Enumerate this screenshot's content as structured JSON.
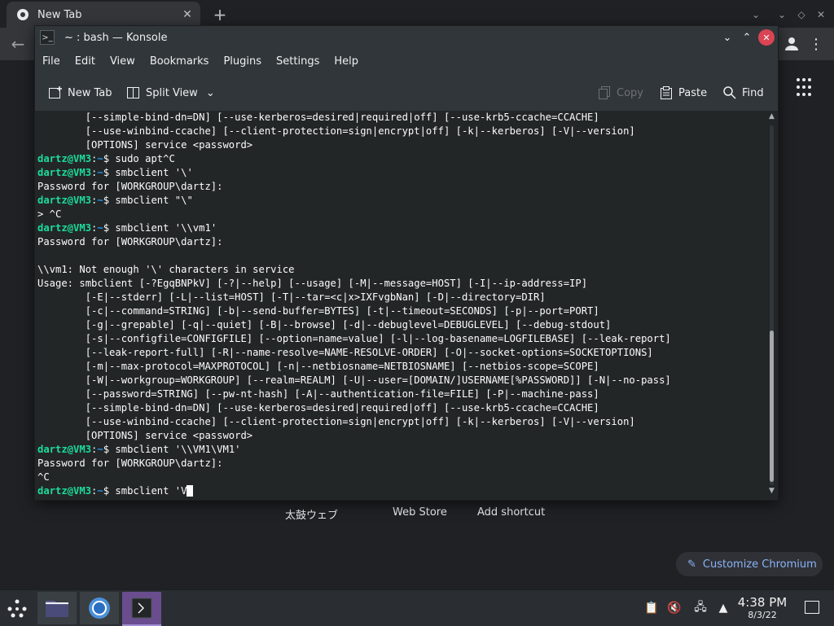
{
  "chromium": {
    "tab_title": "New Tab",
    "tab_close": "✕",
    "new_tab": "+",
    "shortcuts": [
      "太鼓ウェブ",
      "Web Store",
      "Add shortcut"
    ],
    "customize_label": "Customize Chromium"
  },
  "konsole": {
    "title": "~ : bash — Konsole",
    "menu": [
      "File",
      "Edit",
      "View",
      "Bookmarks",
      "Plugins",
      "Settings",
      "Help"
    ],
    "toolbar": {
      "new_tab": "New Tab",
      "split_view": "Split View",
      "copy": "Copy",
      "paste": "Paste",
      "find": "Find"
    },
    "prompt": {
      "user": "dartz@VM3",
      "sep": ":",
      "path": "~",
      "dollar": "$ "
    },
    "terminal_lines": [
      {
        "text": "        [--simple-bind-dn=DN] [--use-kerberos=desired|required|off] [--use-krb5-ccache=CCACHE]"
      },
      {
        "text": "        [--use-winbind-ccache] [--client-protection=sign|encrypt|off] [-k|--kerberos] [-V|--version]"
      },
      {
        "text": "        [OPTIONS] service <password>"
      },
      {
        "prompt": true,
        "cmd": "sudo apt^C"
      },
      {
        "prompt": true,
        "cmd": "smbclient '\\'"
      },
      {
        "text": "Password for [WORKGROUP\\dartz]:"
      },
      {
        "prompt": true,
        "cmd": "smbclient \"\\\""
      },
      {
        "text": "> ^C"
      },
      {
        "prompt": true,
        "cmd": "smbclient '\\\\vm1'"
      },
      {
        "text": "Password for [WORKGROUP\\dartz]:"
      },
      {
        "text": ""
      },
      {
        "text": "\\\\vm1: Not enough '\\' characters in service"
      },
      {
        "text": "Usage: smbclient [-?EgqBNPkV] [-?|--help] [--usage] [-M|--message=HOST] [-I|--ip-address=IP]"
      },
      {
        "text": "        [-E|--stderr] [-L|--list=HOST] [-T|--tar=<c|x>IXFvgbNan] [-D|--directory=DIR]"
      },
      {
        "text": "        [-c|--command=STRING] [-b|--send-buffer=BYTES] [-t|--timeout=SECONDS] [-p|--port=PORT]"
      },
      {
        "text": "        [-g|--grepable] [-q|--quiet] [-B|--browse] [-d|--debuglevel=DEBUGLEVEL] [--debug-stdout]"
      },
      {
        "text": "        [-s|--configfile=CONFIGFILE] [--option=name=value] [-l|--log-basename=LOGFILEBASE] [--leak-report]"
      },
      {
        "text": "        [--leak-report-full] [-R|--name-resolve=NAME-RESOLVE-ORDER] [-O|--socket-options=SOCKETOPTIONS]"
      },
      {
        "text": "        [-m|--max-protocol=MAXPROTOCOL] [-n|--netbiosname=NETBIOSNAME] [--netbios-scope=SCOPE]"
      },
      {
        "text": "        [-W|--workgroup=WORKGROUP] [--realm=REALM] [-U|--user=[DOMAIN/]USERNAME[%PASSWORD]] [-N|--no-pass]"
      },
      {
        "text": "        [--password=STRING] [--pw-nt-hash] [-A|--authentication-file=FILE] [-P|--machine-pass]"
      },
      {
        "text": "        [--simple-bind-dn=DN] [--use-kerberos=desired|required|off] [--use-krb5-ccache=CCACHE]"
      },
      {
        "text": "        [--use-winbind-ccache] [--client-protection=sign|encrypt|off] [-k|--kerberos] [-V|--version]"
      },
      {
        "text": "        [OPTIONS] service <password>"
      },
      {
        "prompt": true,
        "cmd": "smbclient '\\\\VM1\\VM1'"
      },
      {
        "text": "Password for [WORKGROUP\\dartz]:"
      },
      {
        "text": "^C"
      },
      {
        "prompt": true,
        "cmd": "smbclient 'V",
        "cursor": " "
      }
    ]
  },
  "taskbar": {
    "time": "4:38 PM",
    "date": "8/3/22"
  },
  "colors": {
    "terminal_bg": "#232627",
    "prompt_user": "#1cdc9a",
    "prompt_path": "#1d99f3",
    "close_button": "#da4453",
    "konsole_task_active": "#6a4d8f"
  }
}
